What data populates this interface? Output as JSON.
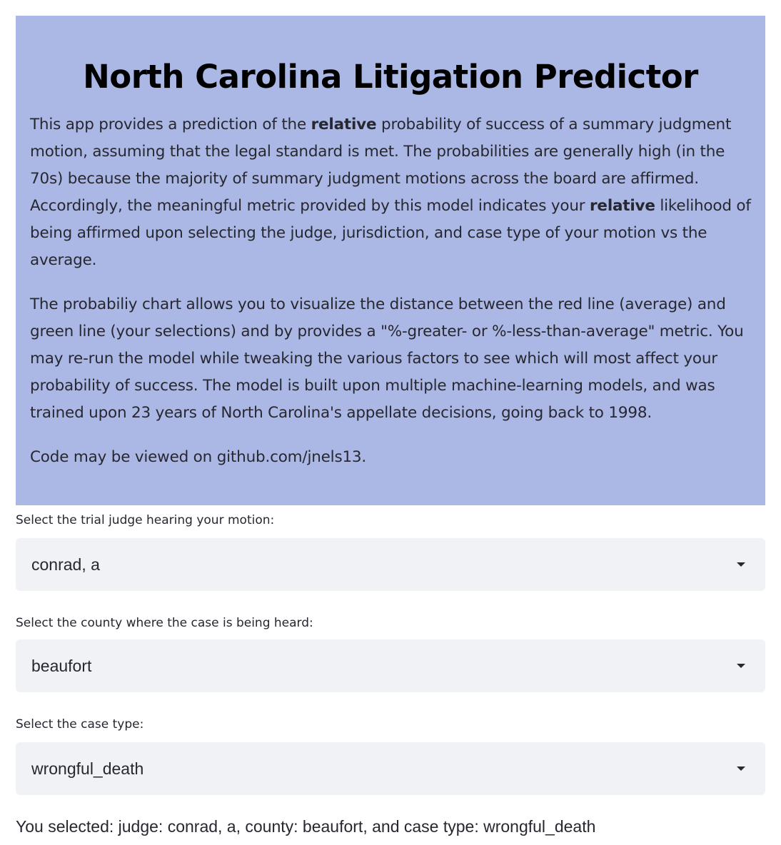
{
  "intro": {
    "title": "North Carolina Litigation Predictor",
    "p1": {
      "a": "This app provides a prediction of the ",
      "b": "relative",
      "c": " probability of success of a summary judgment motion, assuming that the legal standard is met. The probabilities are generally high (in the 70s) because the majority of summary judgment motions across the board are affirmed. Accordingly, the meaningful metric provided by this model indicates your ",
      "d": "relative",
      "e": " likelihood of being affirmed upon selecting the judge, jurisdiction, and case type of your motion vs the average."
    },
    "p2": "The probabiliy chart allows you to visualize the distance between the red line (average) and green line (your selections) and by provides a \"%-greater- or %-less-than-average\" metric. You may re-run the model while tweaking the various factors to see which will most affect your probability of success. The model is built upon multiple machine-learning models, and was trained upon 23 years of North Carolina's appellate decisions, going back to 1998.",
    "p3": "Code may be viewed on github.com/jnels13."
  },
  "judge": {
    "label": "Select the trial judge hearing your motion:",
    "value": "conrad, a"
  },
  "county": {
    "label": "Select the county where the case is being heard:",
    "value": "beaufort"
  },
  "case_type": {
    "label": "Select the case type:",
    "value": "wrongful_death"
  },
  "summary": "You selected: judge: conrad, a, county: beaufort, and case type: wrongful_death",
  "colors": {
    "intro_background": "#abb8e5",
    "select_background": "#f0f2f6",
    "text": "#262730"
  },
  "icons": {
    "dropdown": "chevron-down-icon"
  }
}
